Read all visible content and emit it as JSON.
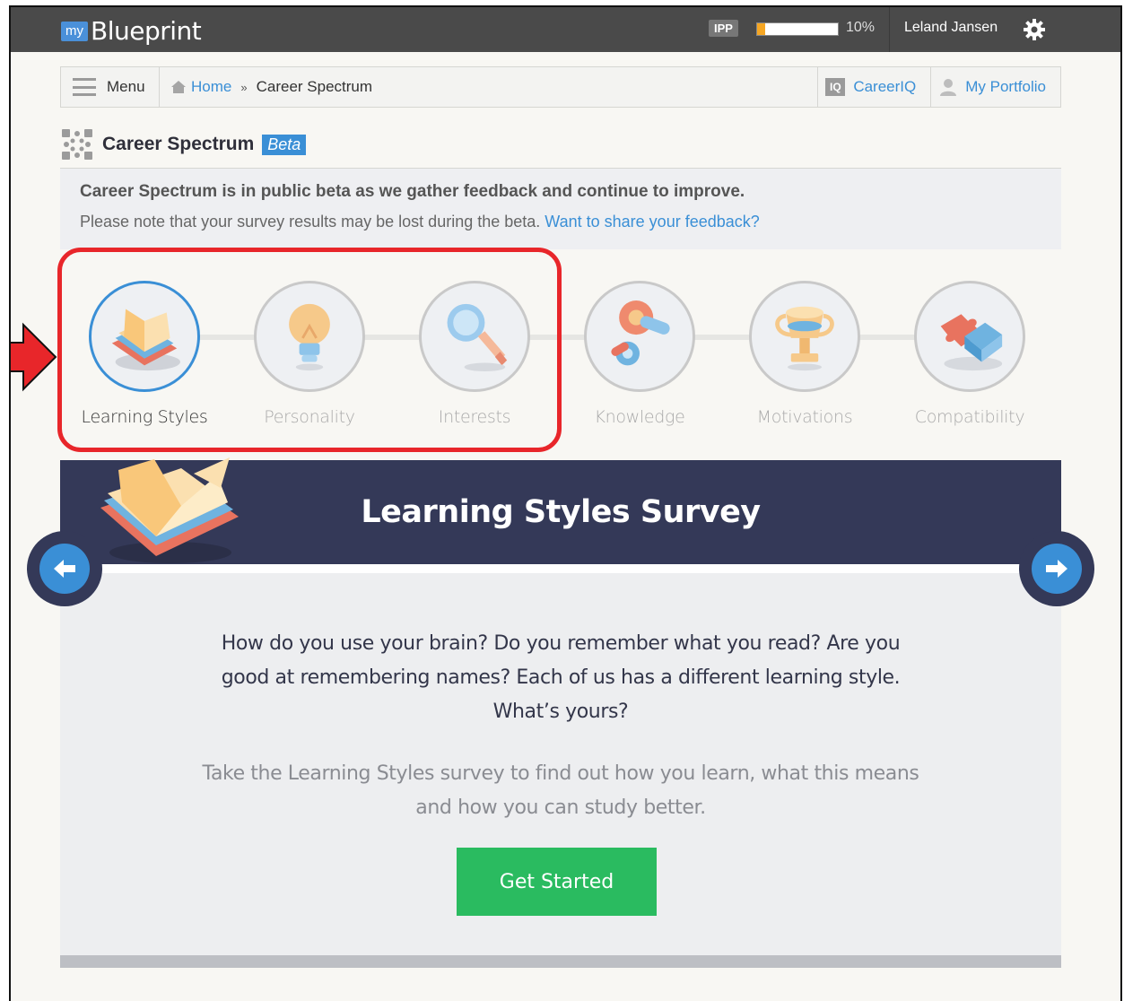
{
  "app": {
    "logo_my": "my",
    "logo_name": "Blueprint"
  },
  "topbar": {
    "ipp_label": "IPP",
    "ipp_progress": 0.1,
    "ipp_percent": "10%",
    "user_name": "Leland Jansen",
    "settings_icon": "gear-icon"
  },
  "nav": {
    "menu_label": "Menu",
    "breadcrumb": {
      "home": "Home",
      "separator": "»",
      "current": "Career Spectrum"
    },
    "careeriq_badge": "IQ",
    "careeriq": "CareerIQ",
    "portfolio": "My Portfolio"
  },
  "page": {
    "title": "Career Spectrum",
    "badge": "Beta"
  },
  "notice": {
    "line1": "Career Spectrum is in public beta as we gather feedback and continue to improve.",
    "line2": "Please note that your survey results may be lost during the beta.",
    "link": "Want to share your feedback?"
  },
  "steps": [
    {
      "label": "Learning Styles",
      "icon": "book-icon",
      "active": true
    },
    {
      "label": "Personality",
      "icon": "lightbulb-icon",
      "active": false
    },
    {
      "label": "Interests",
      "icon": "magnifier-icon",
      "active": false
    },
    {
      "label": "Knowledge",
      "icon": "gears-icon",
      "active": false
    },
    {
      "label": "Motivations",
      "icon": "trophy-icon",
      "active": false
    },
    {
      "label": "Compatibility",
      "icon": "puzzle-icon",
      "active": false
    }
  ],
  "survey": {
    "title": "Learning Styles Survey",
    "question": "How do you use your brain? Do you remember what you read? Are you good at remembering names? Each of us has a different learning style. What’s yours?",
    "description": "Take the Learning Styles survey to find out how you learn, what this means and how you can study better.",
    "button": "Get Started"
  },
  "colors": {
    "accent": "#3a8fd6",
    "banner": "#343958",
    "button": "#2abb60",
    "highlight": "#e8262a",
    "progress": "#f5a623"
  }
}
